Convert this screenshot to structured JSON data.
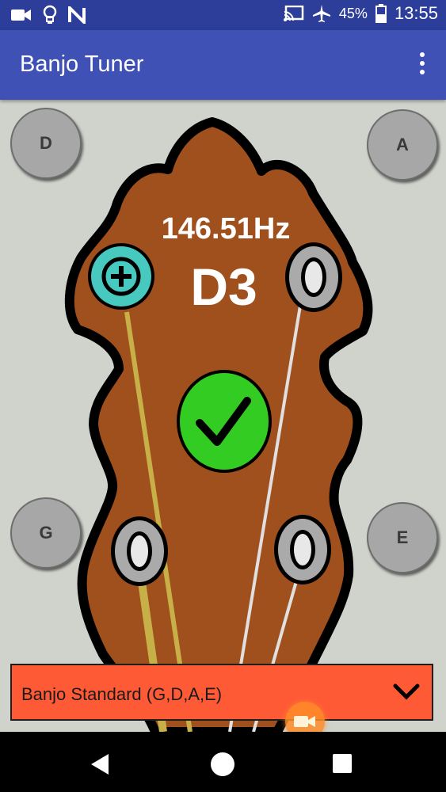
{
  "status_bar": {
    "battery_percent": "45%",
    "time": "13:55",
    "icons": [
      "video-camera-icon",
      "lightbulb-icon",
      "n-icon",
      "cast-icon",
      "airplane-mode-icon",
      "battery-icon"
    ]
  },
  "app_bar": {
    "title": "Banjo Tuner",
    "overflow_icon": "more-vert-icon"
  },
  "tuner": {
    "frequency": "146.51Hz",
    "note": "D3",
    "in_tune": true,
    "pegs": {
      "top_left": "D",
      "top_right": "A",
      "bottom_left": "G",
      "bottom_right": "E"
    },
    "colors": {
      "headstock": "#a0501c",
      "peg_add": "#47c9c0",
      "check": "#33cc22",
      "dropdown": "#ff5a36"
    }
  },
  "tuning_select": {
    "selected": "Banjo Standard (G,D,A,E)"
  },
  "nav_bar": {
    "icons": [
      "back-icon",
      "home-icon",
      "recents-icon"
    ]
  }
}
